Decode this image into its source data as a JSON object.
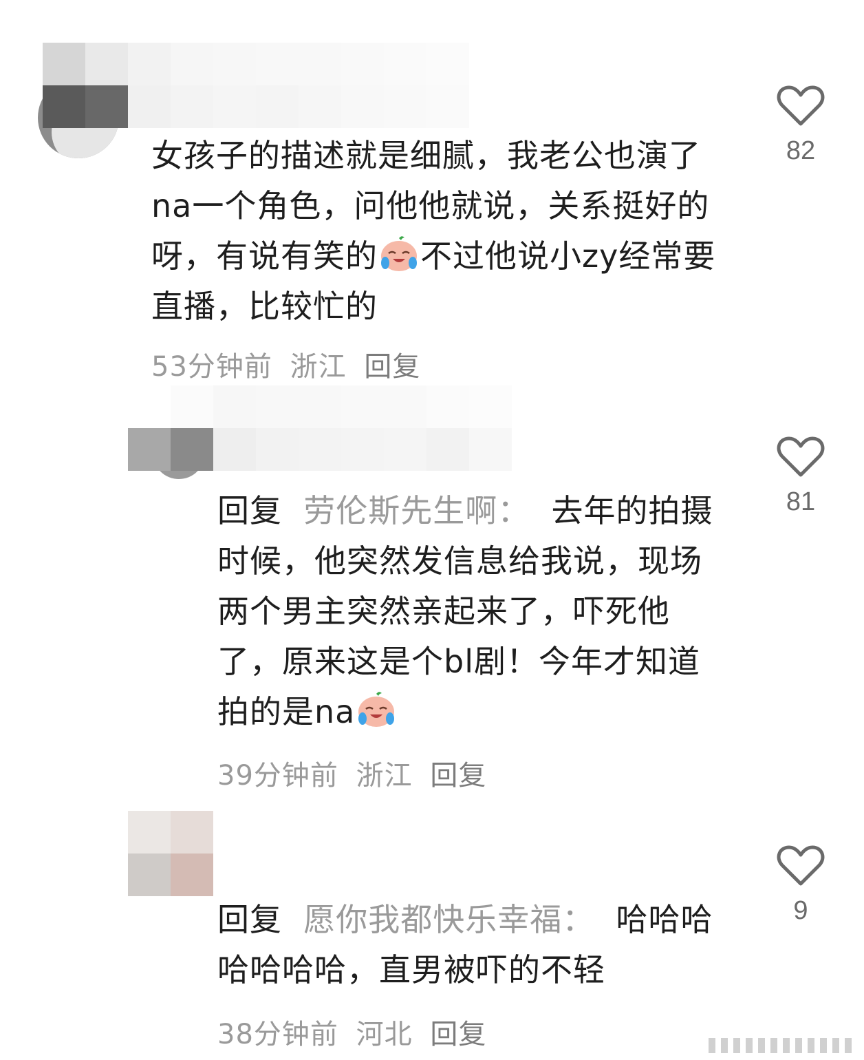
{
  "comments": [
    {
      "text_before": "女孩子的描述就是细腻，我老公也演了na一个角色，问他他就说，关系挺好的呀，有说有笑的",
      "emoji": "crying-laughing-bun",
      "text_after": "不过他说小zy经常要直播，比较忙的",
      "time": "53分钟前",
      "location": "浙江",
      "reply": "回复",
      "likes": "82"
    },
    {
      "reply_prefix": "回复",
      "reply_target": "劳伦斯先生啊：",
      "text_before": "去年的拍摄时候，他突然发信息给我说，现场两个男主突然亲起来了，吓死他了，原来这是个bl剧！今年才知道拍的是na",
      "emoji": "crying-laughing-bun",
      "time": "39分钟前",
      "location": "浙江",
      "reply": "回复",
      "likes": "81"
    },
    {
      "reply_prefix": "回复",
      "reply_target": "愿你我都快乐幸福：",
      "text_before": "哈哈哈哈哈哈哈，直男被吓的不轻",
      "time": "38分钟前",
      "location": "河北",
      "reply": "回复",
      "likes": "9"
    }
  ],
  "icons": {
    "like": "heart-outline-icon"
  },
  "colors": {
    "text": "#1e1e1e",
    "muted": "#9a9a9a",
    "icon": "#6a6a6a"
  }
}
